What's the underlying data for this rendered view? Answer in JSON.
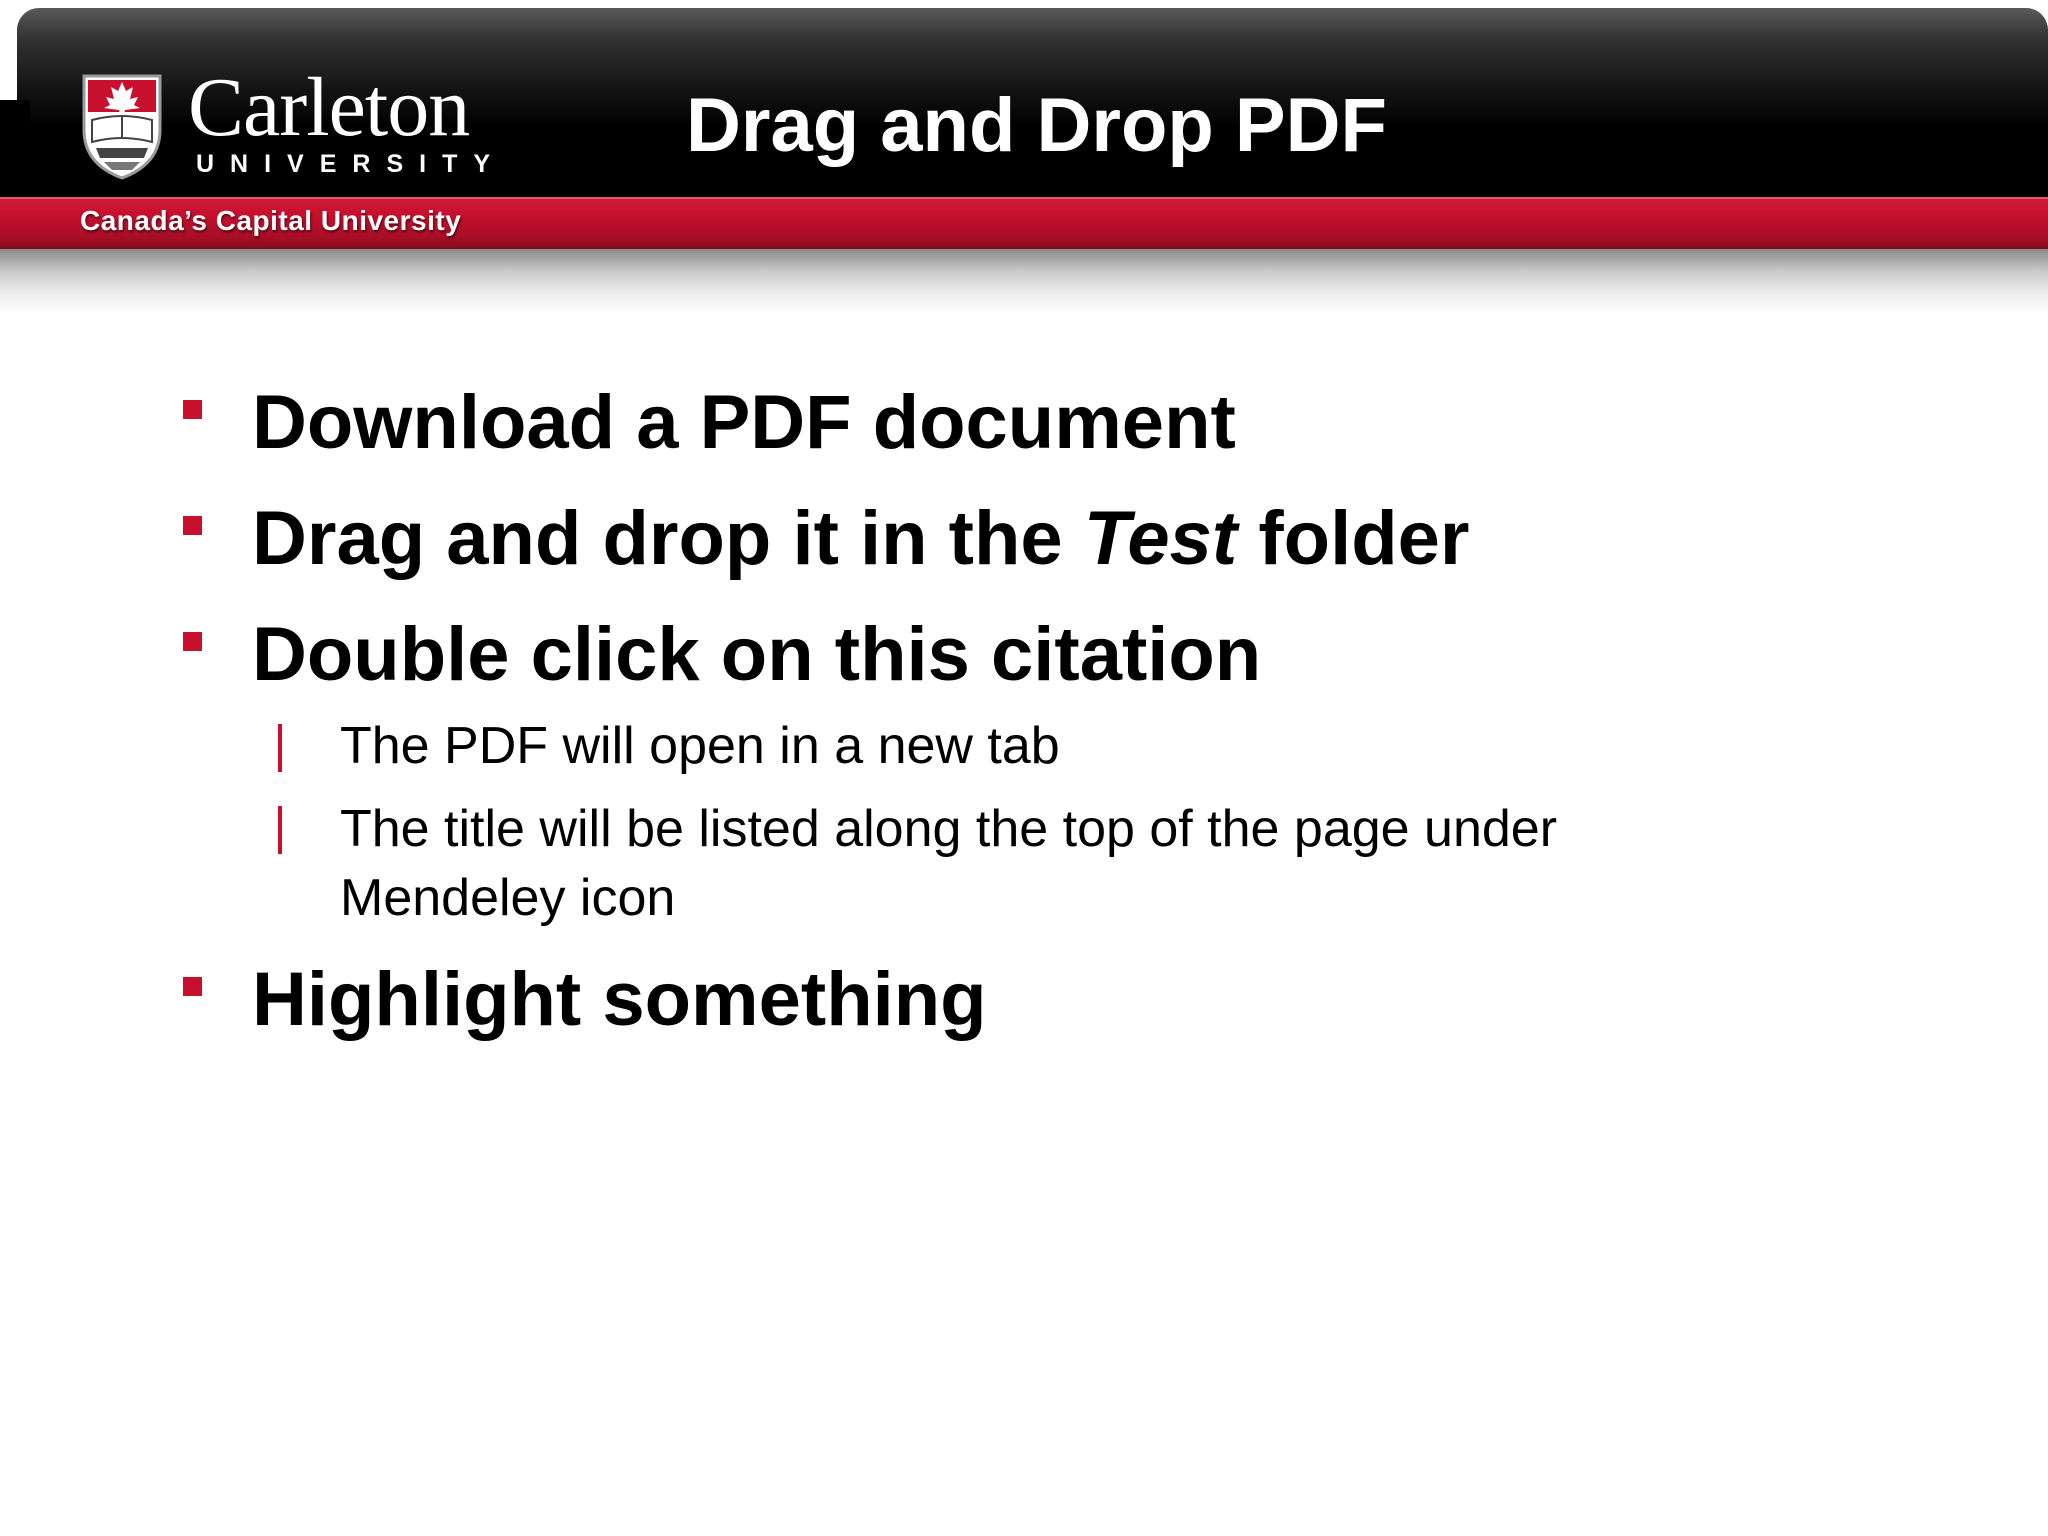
{
  "header": {
    "logo_wordmark": "Carleton",
    "logo_subword": "UNIVERSITY",
    "tagline": "Canada’s Capital University",
    "title": "Drag and Drop PDF"
  },
  "bullets": [
    {
      "text": "Download a PDF document"
    },
    {
      "before": "Drag and drop it in the ",
      "italic": "Test",
      "after": " folder"
    },
    {
      "text": "Double click on this citation",
      "sub": [
        {
          "text": "The PDF will open in a new tab"
        },
        {
          "line1": "The title will be listed along the top of the page under",
          "line2": "Mendeley icon"
        }
      ]
    },
    {
      "text": "Highlight something"
    }
  ],
  "colors": {
    "accent_red": "#c8102e",
    "header_black": "#000000",
    "text": "#000000"
  }
}
